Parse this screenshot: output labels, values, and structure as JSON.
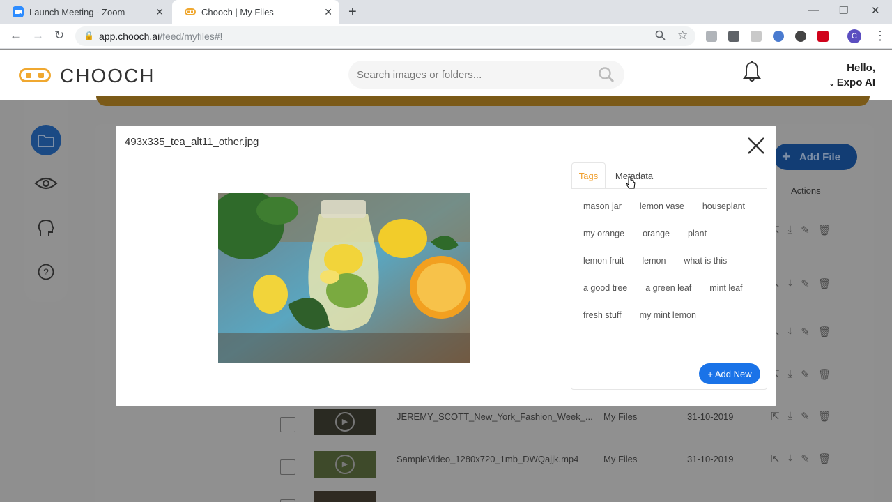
{
  "browser": {
    "tabs": [
      {
        "title": "Launch Meeting - Zoom",
        "favicon": "zoom-icon"
      },
      {
        "title": "Chooch | My Files",
        "favicon": "chooch-icon",
        "active": true
      }
    ],
    "url_host": "app.chooch.ai",
    "url_path": "/feed/myfiles#!",
    "profile_initial": "C"
  },
  "app": {
    "logo_text": "CHOOCH",
    "search_placeholder": "Search images or folders...",
    "greeting": "Hello,",
    "user_name": "Expo AI",
    "colors": {
      "brand_orange": "#f0a830",
      "primary_blue": "#1a73e8",
      "nav_blue": "#1b4a84"
    }
  },
  "background": {
    "add_file_label": "Add File",
    "actions_header": "Actions",
    "rows": [
      {
        "name": "JEREMY_SCOTT_New_York_Fashion_Week_...",
        "location": "My Files",
        "date": "31-10-2019"
      },
      {
        "name": "SampleVideo_1280x720_1mb_DWQajjk.mp4",
        "location": "My Files",
        "date": "31-10-2019"
      }
    ]
  },
  "modal": {
    "title": "493x335_tea_alt11_other.jpg",
    "tabs": {
      "tags": "Tags",
      "metadata": "Metadata"
    },
    "tags": [
      "mason jar",
      "lemon vase",
      "houseplant",
      "my orange",
      "orange",
      "plant",
      "lemon fruit",
      "lemon",
      "what is this",
      "a good tree",
      "a green leaf",
      "mint leaf",
      "fresh stuff",
      "my mint lemon"
    ],
    "add_new_label": "+ Add New"
  }
}
